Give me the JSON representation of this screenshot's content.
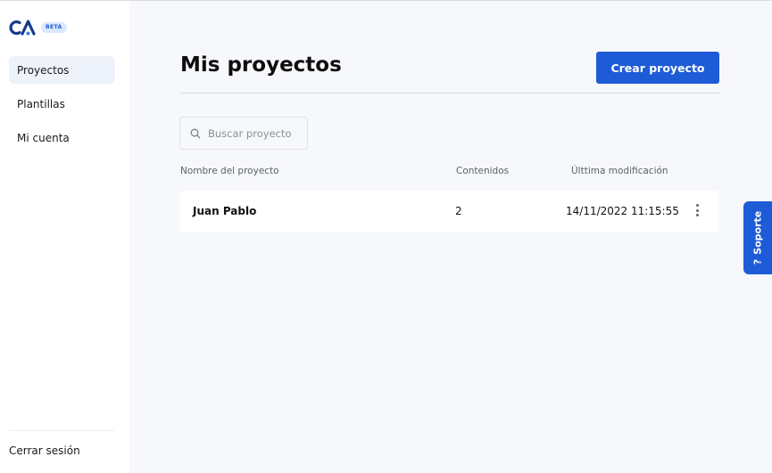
{
  "brand": {
    "logo_text": "CA",
    "badge": "BETA",
    "accent": "#1e5bd6"
  },
  "sidebar": {
    "items": [
      {
        "label": "Proyectos",
        "active": true
      },
      {
        "label": "Plantillas",
        "active": false
      },
      {
        "label": "Mi cuenta",
        "active": false
      }
    ],
    "logout_label": "Cerrar sesión"
  },
  "main": {
    "title": "Mis proyectos",
    "create_button": "Crear proyecto",
    "search": {
      "placeholder": "Buscar proyecto",
      "value": ""
    },
    "table": {
      "headers": [
        "Nombre del proyecto",
        "Contenidos",
        "Últtima modificación"
      ],
      "rows": [
        {
          "name": "Juan Pablo",
          "contents": "2",
          "modified": "14/11/2022 11:15:55"
        }
      ]
    }
  },
  "support": {
    "label": "Soporte",
    "icon": "question-icon"
  }
}
